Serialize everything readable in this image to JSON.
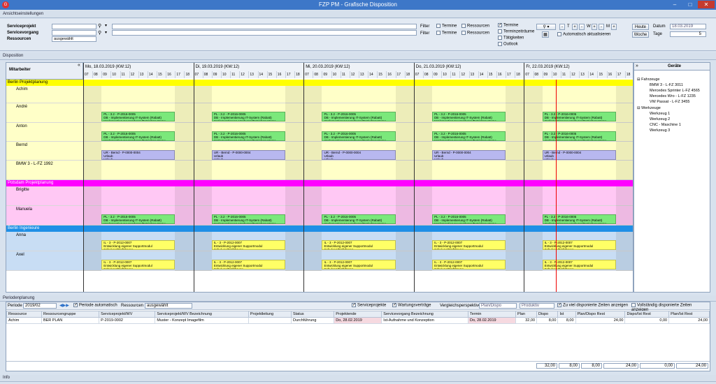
{
  "window": {
    "title": "FZP PM - Grafische Disposition",
    "logo": "G"
  },
  "ansicht": {
    "header": "Ansichtseinstellungen",
    "serviceprojekt_label": "Serviceprojekt",
    "servicevorgang_label": "Servicevorgang",
    "ressourcen_label": "Ressourcen",
    "ressourcen_value": "ausgewählt",
    "filter1": "Filter",
    "filter2": "Filter",
    "termine": "Termine",
    "ressourcen_chk": "Ressourcen",
    "opt_termine": "Termine",
    "opt_terminzeitraeume": "Terminzeiträume",
    "opt_taetigkeiten": "Tätigkeiten",
    "opt_outlook": "Outlook",
    "auto_update": "Automatisch aktualisieren",
    "zoom_t": "T",
    "zoom_w": "W",
    "zoom_m": "M",
    "btn_heute": "Heute",
    "btn_woche": "Woche",
    "datum_label": "Datum",
    "datum_value": "18.03.2019",
    "tage_label": "Tage",
    "tage_value": "5"
  },
  "disposition": {
    "header": "Disposition",
    "mitarbeiter_header": "Mitarbeiter",
    "geraete_header": "Geräte"
  },
  "days": [
    "Mo, 18.03.2019 (KW:12)",
    "Di, 19.03.2019 (KW:12)",
    "Mi, 20.03.2019 (KW:12)",
    "Do, 21.03.2019 (KW:12)",
    "Fr, 22.03.2019 (KW:12)"
  ],
  "hours": [
    "07",
    "08",
    "09",
    "10",
    "11",
    "12",
    "13",
    "14",
    "15",
    "16",
    "17",
    "18"
  ],
  "groups": [
    {
      "name": "Berlin Projektplanung",
      "color": "#ffff00"
    },
    {
      "name": "Potsdam Projektplanung",
      "color": "#ff00ff"
    },
    {
      "name": "Berlin Ingenieure",
      "color": "#1f8fe6"
    }
  ],
  "people": [
    "Achim",
    "André",
    "Anton",
    "Bernd",
    "BMW 3 - L-FZ 1992",
    "Brigitte",
    "Manuela",
    "Anna",
    "Axel"
  ],
  "tasks": {
    "green": [
      "PL - 3.2 - P-2016-0005",
      "DB - Implementierung IT-System (Rabatt)",
      "Implementierung Hardware/Betriebssysteme"
    ],
    "purple": [
      "UR - Bernd - P-0000-0004",
      "Urlaub",
      "Urlaub"
    ],
    "yellow": [
      "IL - 3 - P-2012-0007",
      "Entwicklung eigener Supportmodul",
      "Schulung/Einführung"
    ]
  },
  "geraete": {
    "fahrzeuge": "Fahrzeuge",
    "fahrzeuge_items": [
      "BMW 3 - L-FZ 3011",
      "Mercedes Sprinter L-FZ 4565",
      "Mercedes Wro - L-FZ 1235",
      "VW Passat - L-FZ 3455"
    ],
    "werkzeuge": "Werkzeuge",
    "werkzeuge_items": [
      "Werkzeug 1",
      "Werkzeug 2",
      "CNC - Maschine 1",
      "Werkzeug 3"
    ]
  },
  "periodenplanung": {
    "header": "Periodenplanung",
    "periode_label": "Periode",
    "periode_value": "2019/02",
    "periode_auto": "Periode automatisch",
    "ressourcen_label": "Ressourcen",
    "ressourcen_value": "ausgewählt",
    "chk_serviceprojekte": "Serviceprojekte",
    "chk_wartungsvertraege": "Wartungsverträge",
    "vergleich_label": "Vergleichsperspektive",
    "vergleich_value": "Plan/Dispo",
    "produktiv_value": "Produktiv",
    "chk_zu_viel": "Zu viel disponierte Zeiten anzeigen",
    "chk_vollstaendig": "Vollständig disponierte Zeiten anzeigen",
    "columns": [
      "Ressource",
      "Ressourcengruppe",
      "Serviceprojekt/WV",
      "Serviceprojekt/WV Bezeichnung",
      "Projektleitung",
      "Status",
      "Projektende",
      "Servicevorgang Bezeichnung",
      "Termin",
      "Plan",
      "Dispo",
      "Ist",
      "Plan/Dispo Rest",
      "Dispo/Ist Rest",
      "Plan/Ist Rest"
    ],
    "rows": [
      [
        "Achim",
        "BER PLAN",
        "P-2019-0002",
        "Muster - Konzept Imagefilm",
        "",
        "Durchführung",
        "Do, 28.02.2019",
        "Ist-Aufnahme und Konzeption",
        "Do, 28.02.2019",
        "32,00",
        "8,00",
        "8,00",
        "24,00",
        "0,00",
        "24,00"
      ]
    ],
    "totals": [
      "32,00",
      "8,00",
      "8,00",
      "24,00",
      "0,00",
      "24,00"
    ]
  },
  "info": {
    "header": "Info"
  }
}
